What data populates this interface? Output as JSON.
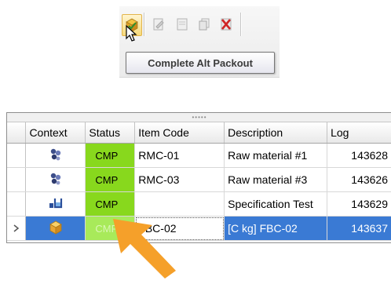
{
  "toolbar": {
    "buttons": [
      {
        "icon": "complete-alt-packout-icon",
        "active": true
      },
      {
        "icon": "document-edit-icon",
        "active": false
      },
      {
        "icon": "document-icon",
        "active": false
      },
      {
        "icon": "document-copy-icon",
        "active": false
      },
      {
        "icon": "delete-icon",
        "active": false
      }
    ],
    "tooltip": "Complete Alt Packout"
  },
  "grid": {
    "columns": [
      "Context",
      "Status",
      "Item Code",
      "Description",
      "Log"
    ],
    "rows": [
      {
        "context_icon": "molecule-icon",
        "status": "CMP",
        "item_code": "RMC-01",
        "description": "Raw material #1",
        "log": "143628",
        "selected": false
      },
      {
        "context_icon": "molecule-icon",
        "status": "CMP",
        "item_code": "RMC-03",
        "description": "Raw material #3",
        "log": "143626",
        "selected": false
      },
      {
        "context_icon": "specification-icon",
        "status": "CMP",
        "item_code": "",
        "description": "Specification Test",
        "log": "143629",
        "selected": false
      },
      {
        "context_icon": "package-icon",
        "status": "CMP",
        "item_code": "FBC-02",
        "description": "[C kg]  FBC-02",
        "log": "143637",
        "selected": true
      }
    ]
  },
  "colors": {
    "status_green": "#88d81d",
    "selection_blue": "#3a7ad4",
    "arrow_orange": "#f5a02a"
  }
}
